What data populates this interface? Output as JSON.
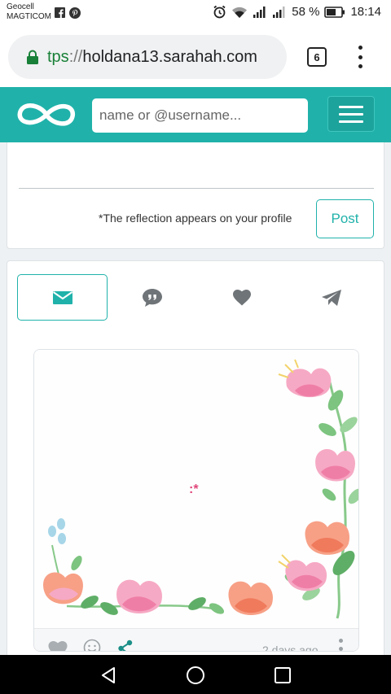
{
  "status_bar": {
    "carrier_line1": "Geocell",
    "carrier_line2": "MAGTICOM",
    "battery": "58 %",
    "time": "18:14",
    "icons": [
      "facebook-icon",
      "pinterest-icon",
      "alarm-icon",
      "wifi-icon",
      "signal-icon",
      "signal-icon",
      "battery-icon"
    ]
  },
  "browser": {
    "url_scheme": "tps",
    "url_sep": "://",
    "url_host": "holdana13.sarahah.com",
    "tab_count": "6"
  },
  "header": {
    "search_placeholder": "name or @username..."
  },
  "composer": {
    "note": "*The reflection appears on your profile",
    "post_label": "Post"
  },
  "tabs": [
    {
      "icon": "envelope-icon",
      "active": true
    },
    {
      "icon": "quote-bubble-icon",
      "active": false
    },
    {
      "icon": "heart-icon",
      "active": false
    },
    {
      "icon": "paper-plane-icon",
      "active": false
    }
  ],
  "message": {
    "text": ":*",
    "date": "2 days ago"
  },
  "colors": {
    "accent": "#20b2aa",
    "pink": "#f49ab8",
    "coral": "#f38a6e",
    "leaf": "#7cc47f"
  }
}
